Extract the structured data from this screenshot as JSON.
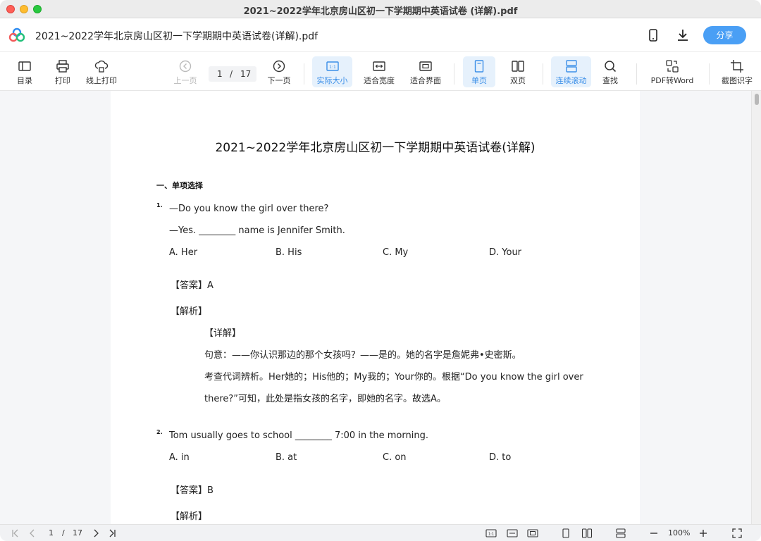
{
  "window": {
    "title": "2021~2022学年北京房山区初一下学期期中英语试卷 (详解).pdf"
  },
  "header": {
    "doc_title": "2021~2022学年北京房山区初一下学期期中英语试卷(详解).pdf",
    "share_label": "分享",
    "icons": [
      "app-logo",
      "phone-icon",
      "download-icon"
    ]
  },
  "toolbar": {
    "toc": "目录",
    "print": "打印",
    "online_print": "线上打印",
    "prev_page": "上一页",
    "current_page": "1",
    "page_sep": "/",
    "total_pages": "17",
    "next_page": "下一页",
    "actual_size": "实际大小",
    "fit_width": "适合宽度",
    "fit_page": "适合界面",
    "single_page": "单页",
    "double_page": "双页",
    "continuous_scroll": "连续滚动",
    "find": "查找",
    "pdf_to_word": "PDF转Word",
    "ocr": "截图识字",
    "actual_size_glyph": "1:1",
    "active_color": "#3b8fe8"
  },
  "document": {
    "title": "2021~2022学年北京房山区初一下学期期中英语试卷(详解)",
    "section": "一、单项选择",
    "q1": {
      "num": "1.",
      "line1": "—Do you know the girl over there?",
      "line2": "—Yes. ________ name is Jennifer Smith.",
      "options": [
        "A. Her",
        "B. His",
        "C. My",
        "D. Your"
      ],
      "answer": "【答案】A",
      "analysis": "【解析】",
      "detail": "【详解】",
      "explain1": "句意：——你认识那边的那个女孩吗？——是的。她的名字是詹妮弗•史密斯。",
      "explain2": "考查代词辨析。Her她的；His他的；My我的；Your你的。根据“Do you know the girl over",
      "explain3": "there?”可知，此处是指女孩的名字，即她的名字。故选A。"
    },
    "q2": {
      "num": "2.",
      "line1": "Tom usually goes to school ________ 7:00 in the morning.",
      "options": [
        "A. in",
        "B. at",
        "C. on",
        "D. to"
      ],
      "answer": "【答案】B",
      "analysis": "【解析】"
    }
  },
  "statusbar": {
    "current_page": "1",
    "page_sep": "/",
    "total_pages": "17",
    "zoom": "100%",
    "actual_size_glyph": "1:1"
  }
}
